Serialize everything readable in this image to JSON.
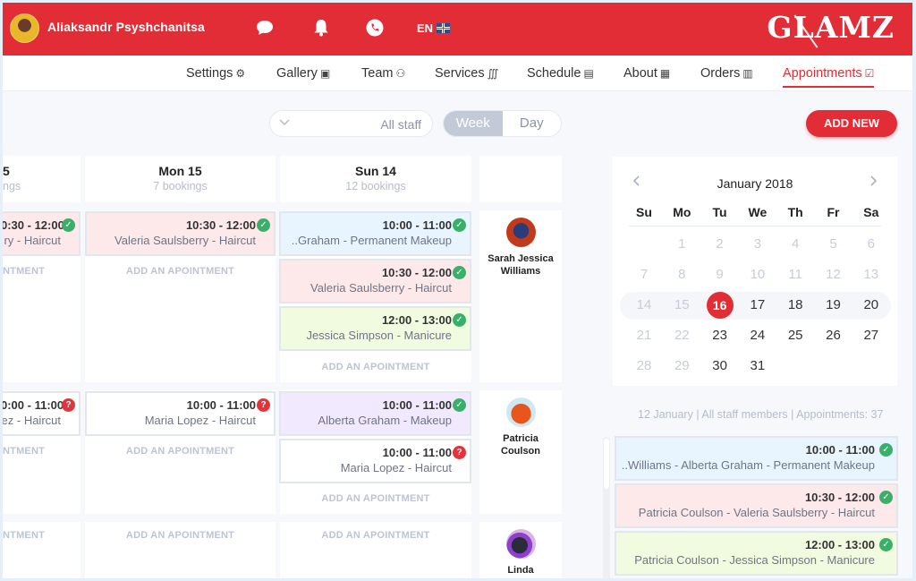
{
  "header": {
    "user_name": "Aliaksandr Psyshchanitsa",
    "icons": [
      "chat-icon",
      "bell-icon",
      "phone-icon"
    ],
    "language": "EN",
    "logo": "GLAMZ",
    "brand_color": "#e22d36"
  },
  "nav": {
    "items": [
      {
        "label": "Settings",
        "icon": "gear-icon",
        "glyph": "⚙"
      },
      {
        "label": "Gallery",
        "icon": "image-icon",
        "glyph": "▣"
      },
      {
        "label": "Team",
        "icon": "team-icon",
        "glyph": "⚇"
      },
      {
        "label": "Services",
        "icon": "services-icon",
        "glyph": "∭"
      },
      {
        "label": "Schedule",
        "icon": "schedule-icon",
        "glyph": "▤"
      },
      {
        "label": "About",
        "icon": "store-icon",
        "glyph": "▦"
      },
      {
        "label": "Orders",
        "icon": "orders-icon",
        "glyph": "▥"
      },
      {
        "label": "Appointments",
        "icon": "calendar-check-icon",
        "glyph": "☑"
      }
    ],
    "active": "Appointments"
  },
  "controls": {
    "staff_select": "All staff",
    "view_week": "Week",
    "view_day": "Day",
    "selected_view": "Week",
    "add_new": "ADD NEW"
  },
  "columns": [
    {
      "day": "5",
      "count": "ngs"
    },
    {
      "day": "Mon 15",
      "count": "7 bookings"
    },
    {
      "day": "Sun 14",
      "count": "12 bookings"
    }
  ],
  "add_appointment_label": "ADD AN APOINTMENT",
  "add_appointment_partial": "NTMENT",
  "rows": [
    {
      "staff": {
        "name": "Sarah Jessica Williams"
      },
      "cells": [
        [
          {
            "time": "0:30 - 12:00",
            "desc": "ry - Haircut",
            "status": "confirmed",
            "color": "pink"
          }
        ],
        [
          {
            "time": "10:30 - 12:00",
            "desc": "Valeria Saulsberry - Haircut",
            "status": "confirmed",
            "color": "pink"
          }
        ],
        [
          {
            "time": "10:00 - 11:00",
            "desc": "..Graham - Permanent Makeup",
            "status": "confirmed",
            "color": "blue"
          },
          {
            "time": "10:30 - 12:00",
            "desc": "Valeria Saulsberry - Haircut",
            "status": "confirmed",
            "color": "pink"
          },
          {
            "time": "12:00 - 13:00",
            "desc": "Jessica Simpson - Manicure",
            "status": "confirmed",
            "color": "green"
          }
        ]
      ]
    },
    {
      "staff": {
        "name": "Patricia Coulson"
      },
      "cells": [
        [
          {
            "time": "0:00 - 11:00",
            "desc": "ez - Haircut",
            "status": "pending",
            "color": "white"
          }
        ],
        [
          {
            "time": "10:00 - 11:00",
            "desc": "Maria Lopez - Haircut",
            "status": "pending",
            "color": "white"
          }
        ],
        [
          {
            "time": "10:00 - 11:00",
            "desc": "Alberta Graham - Makeup",
            "status": "confirmed",
            "color": "purple"
          },
          {
            "time": "10:00 - 11:00",
            "desc": "Maria Lopez - Haircut",
            "status": "pending",
            "color": "white"
          }
        ]
      ]
    },
    {
      "staff": {
        "name": "Linda"
      },
      "cells": [
        [],
        [],
        []
      ]
    }
  ],
  "calendar": {
    "title": "January 2018",
    "weekdays": [
      "Su",
      "Mo",
      "Tu",
      "We",
      "Th",
      "Fr",
      "Sa"
    ],
    "weeks": [
      [
        "",
        "1",
        "2",
        "3",
        "4",
        "5",
        "6"
      ],
      [
        "7",
        "8",
        "9",
        "10",
        "11",
        "12",
        "13"
      ],
      [
        "14",
        "15",
        "16",
        "17",
        "18",
        "19",
        "20"
      ],
      [
        "21",
        "22",
        "23",
        "24",
        "25",
        "26",
        "27"
      ],
      [
        "28",
        "29",
        "30",
        "31",
        "",
        "",
        ""
      ]
    ],
    "selected": "16"
  },
  "summary": {
    "text": "12 January  |  All staff members  |  Appointments: 37"
  },
  "list": [
    {
      "time": "10:00 - 11:00",
      "desc": "..Williams - Alberta Graham - Permanent Makeup",
      "status": "confirmed",
      "color": "blue"
    },
    {
      "time": "10:30 - 12:00",
      "desc": "Patricia Coulson - Valeria Saulsberry - Haircut",
      "status": "confirmed",
      "color": "pink"
    },
    {
      "time": "12:00 - 13:00",
      "desc": "Patricia Coulson - Jessica Simpson - Manicure",
      "status": "confirmed",
      "color": "green"
    }
  ]
}
